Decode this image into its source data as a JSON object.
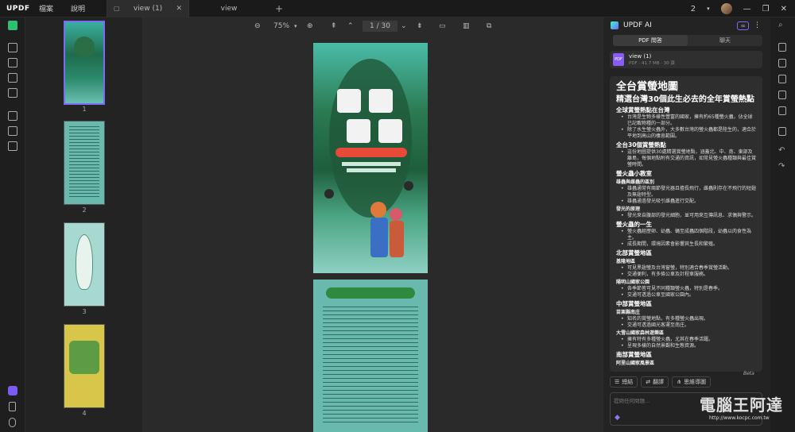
{
  "app": {
    "logo": "UPDF"
  },
  "menu": [
    {
      "label": "檔案"
    },
    {
      "label": "說明"
    }
  ],
  "tabs": [
    {
      "label": "view (1)"
    },
    {
      "label": "view"
    }
  ],
  "window": {
    "count": "2"
  },
  "toolbar": {
    "zoom": "75%",
    "current_page": "1",
    "total_pages": "/ 30"
  },
  "thumbnails": [
    {
      "num": "1"
    },
    {
      "num": "2"
    },
    {
      "num": "3"
    },
    {
      "num": "4"
    }
  ],
  "ai": {
    "title": "UPDF AI",
    "tab_pdf": "PDF 問答",
    "tab_chat": "聊天",
    "file_name": "view (1)",
    "file_meta": "PDF · 41.7 MB · 30 頁",
    "badge": "Beta",
    "summary": {
      "h1": "全台賞螢地圖",
      "h2": "精選台灣30個此生必去的全年賞螢熱點",
      "s1": "全球賞螢熱點在台灣",
      "s1_items": [
        "台灣是生物多樣性豐富的國家，擁有約65種螢火蟲，佔全球已記載物種的一部分。",
        "除了水生螢火蟲外，大多數台灣的螢火蟲都是陸生的，適合於平地到高山的棲息範圍。"
      ],
      "s2": "全台30個賞螢熱點",
      "s2_items": [
        "這份地圖提供30處精選賞螢地點，涵蓋北、中、南、東部及離島，每個地點附有交通的資訊，如常見螢火蟲種類與最佳賞螢時間。"
      ],
      "s3": "螢火蟲小教室",
      "s3a": "雄蟲與雌蟲的區別",
      "s3a_items": [
        "雄蟲通常有兩節發光器且擅長飛行，雌蟲則存在不飛行的短翅及無翅特型。",
        "雄蟲通過發光吸引雌蟲進行交配。"
      ],
      "s3b": "發光的原理",
      "s3b_items": [
        "發光來自腹部的發光細胞，並可用來互傳訊息、求偶與警示。"
      ],
      "s4": "螢火蟲的一生",
      "s4_items": [
        "螢火蟲經歷卵、幼蟲、蛹至成蟲四個階段，幼蟲以肉食性為主。",
        "成長期間，環境因素會影響其生長和繁殖。"
      ],
      "s5": "北部賞螢地區",
      "s5a": "基隆地區",
      "s5a_items": [
        "可見黑翅螢及台灣窗螢，特別適合春季賞螢活動。",
        "交通便利，有多條公車及計程車服務。"
      ],
      "s5b": "陽明山國家公園",
      "s5b_items": [
        "各季節皆可見不同種類螢火蟲，特別是春季。",
        "交通可透過公車至國家公園內。"
      ],
      "s6": "中部賞螢地區",
      "s6a": "苗栗縣南庄",
      "s6a_items": [
        "知名的賞螢地點，有多種螢火蟲出現。",
        "交通可透過國光客運至南庄。"
      ],
      "s6b": "大雪山國家森林遊樂區",
      "s6b_items": [
        "擁有特有多種螢火蟲，尤其在春季活躍。",
        "呈現多樣的自然景觀和生態資源。"
      ],
      "s7": "南部賞螢地區",
      "s7a": "阿里山國家風景區"
    },
    "actions": {
      "a1": "總結",
      "a2": "翻譯",
      "a3": "思維導圖"
    },
    "input_placeholder": "提問任何問題..."
  },
  "watermark": {
    "main": "電腦王阿達",
    "url": "http://www.kocpc.com.tw"
  }
}
